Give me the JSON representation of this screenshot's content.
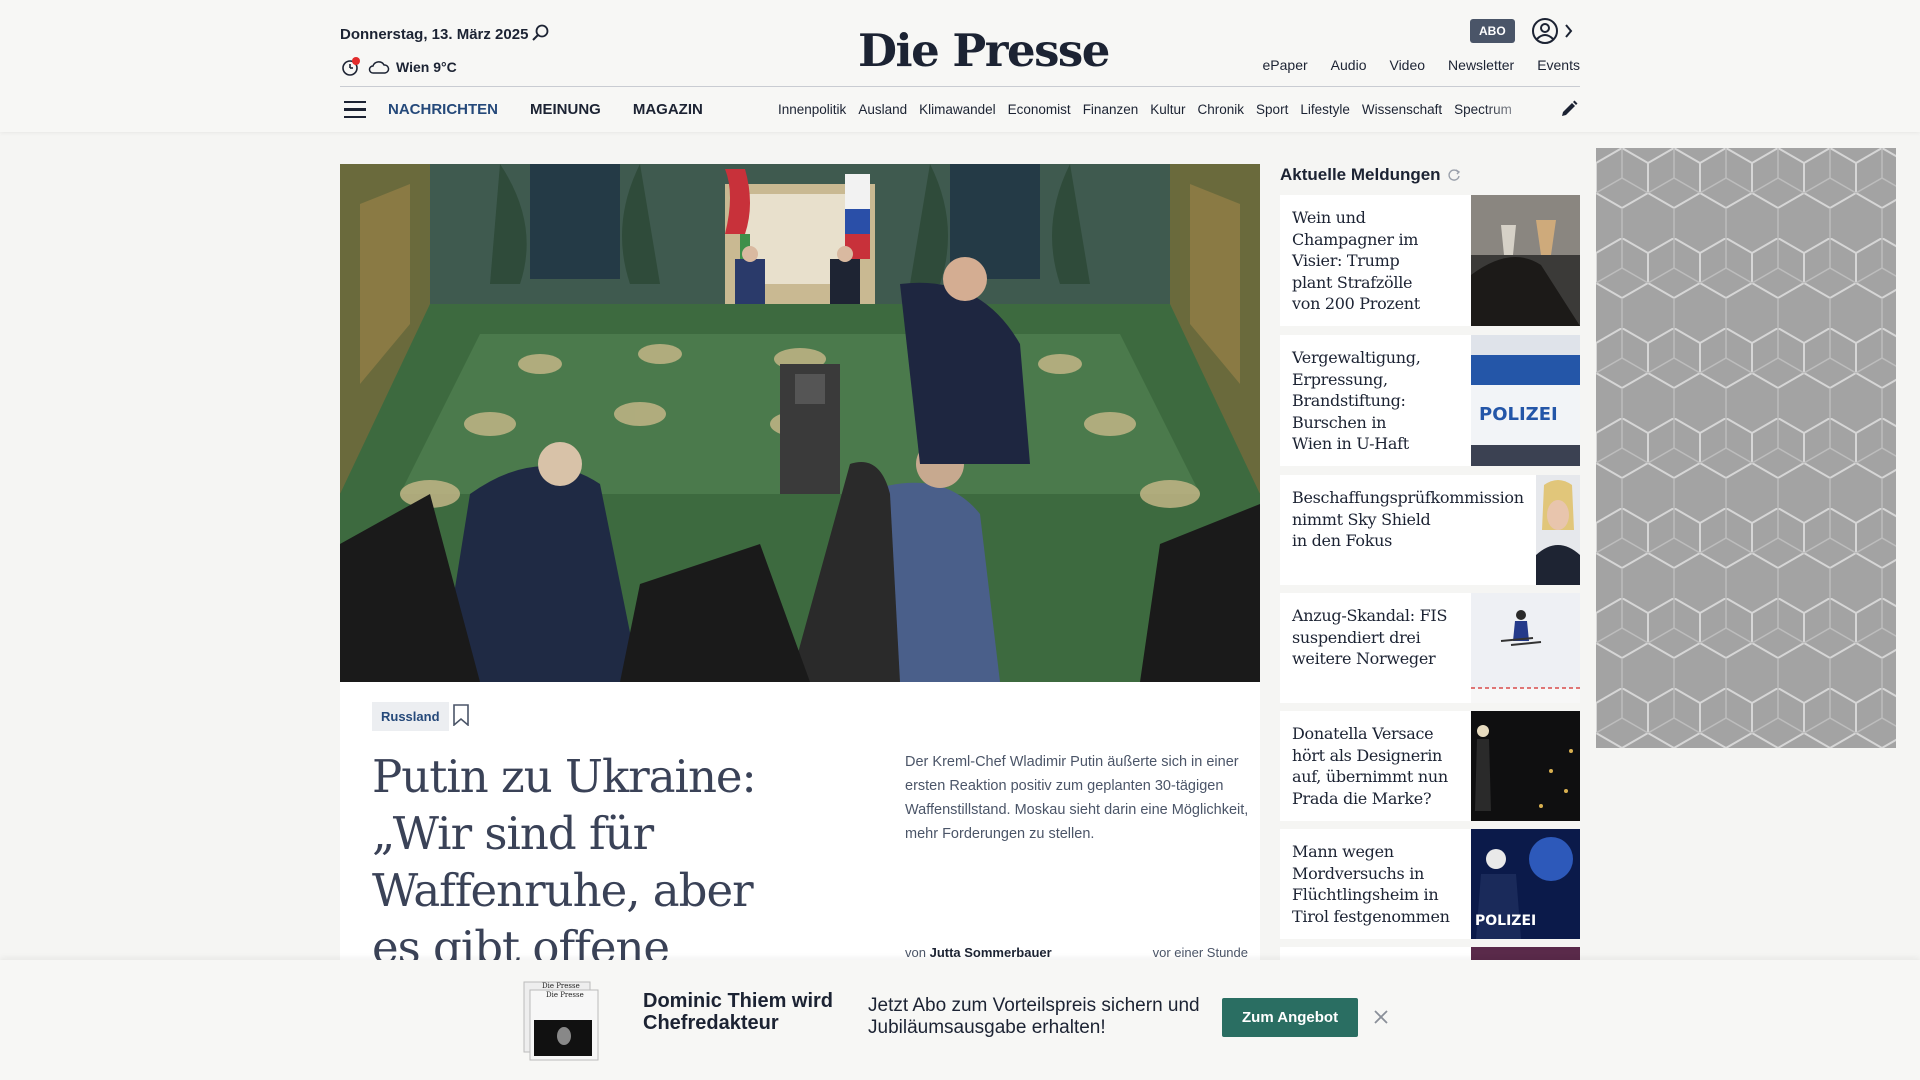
{
  "header": {
    "date": "Donnerstag, 13. März 2025",
    "weather": "Wien 9°C",
    "logo": "Die Presse",
    "abo_label": "ABO",
    "top_links": [
      "ePaper",
      "Audio",
      "Video",
      "Newsletter",
      "Events"
    ]
  },
  "nav": {
    "main": [
      "NACHRICHTEN",
      "MEINUNG",
      "MAGAZIN"
    ],
    "sub": [
      "Innenpolitik",
      "Ausland",
      "Klimawandel",
      "Economist",
      "Finanzen",
      "Kultur",
      "Chronik",
      "Sport",
      "Lifestyle",
      "Wissenschaft",
      "Spectrum"
    ]
  },
  "article": {
    "tag": "Russland",
    "headline": "Putin zu Ukraine: „Wir sind für Waffenruhe, aber es gibt offene Fragen“",
    "teaser": "Der Kreml-Chef Wladimir Putin äußerte sich in einer ersten Reaktion positiv zum geplanten 30-tägigen Waffenstillstand. Moskau sieht darin eine Möglichkeit, mehr Forderungen zu stellen.",
    "byline_prefix": "von",
    "author": "Jutta Sommerbauer",
    "time": "vor einer Stunde"
  },
  "aside": {
    "title": "Aktuelle Meldungen",
    "items": [
      {
        "lines": [
          "Wein und",
          "Champagner im",
          "Visier: Trump",
          "plant Strafzölle",
          "von 200 Prozent"
        ]
      },
      {
        "lines": [
          "Vergewaltigung,",
          "Erpressung,",
          "Brandstiftung:",
          "Burschen in",
          "Wien in U-Haft"
        ]
      },
      {
        "lines": [
          "Beschaffungsprüfkommission",
          "nimmt Sky Shield",
          "in den Fokus"
        ]
      },
      {
        "lines": [
          "Anzug-Skandal: FIS",
          "suspendiert drei",
          "weitere Norweger"
        ]
      },
      {
        "lines": [
          "Donatella Versace",
          "hört als Designerin",
          "auf, übernimmt nun",
          "Prada die Marke?"
        ]
      },
      {
        "lines": [
          "Mann wegen",
          "Mordversuchs in",
          "Flüchtlingsheim in",
          "Tirol festgenommen"
        ]
      }
    ],
    "police_text": "POLIZEI"
  },
  "promo": {
    "name": "Dominic Thiem wird Chefredakteur",
    "text": "Jetzt Abo zum Vorteilspreis sichern und Jubiläumsausgabe erhalten!",
    "button": "Zum Angebot",
    "mini_logo": "Die Presse"
  }
}
